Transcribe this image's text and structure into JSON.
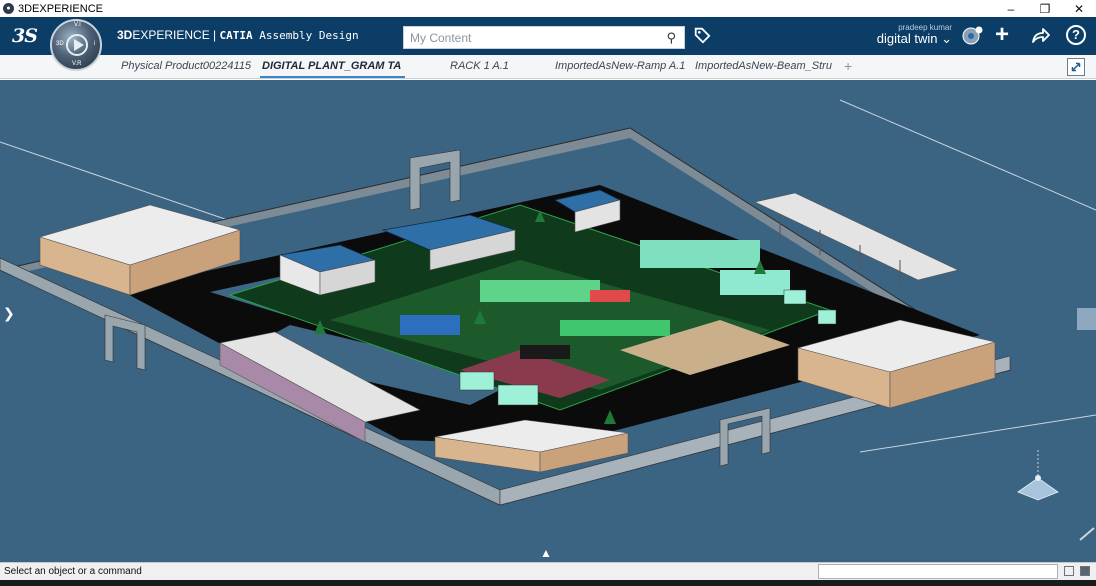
{
  "window": {
    "title": "3DEXPERIENCE"
  },
  "topbar": {
    "logo_text": "3S",
    "brand_bold": "3D",
    "brand_rest": "EXPERIENCE | ",
    "brand_app": "CATIA",
    "brand_module": " Assembly Design",
    "compass_top": "V.I",
    "compass_left": "3D",
    "compass_right": "i",
    "compass_bottom": "V.R",
    "search_placeholder": "My Content",
    "user_name": "pradeep kumar",
    "context_label": "digital twin",
    "colors": {
      "bar": "#0c3d66",
      "accent": "#3d86c6"
    }
  },
  "tabs": [
    {
      "label": "Physical Product00224115",
      "active": false
    },
    {
      "label": "DIGITAL PLANT_GRAM TA",
      "active": true
    },
    {
      "label": "RACK 1 A.1",
      "active": false
    },
    {
      "label": "ImportedAsNew-Ramp A.1",
      "active": false
    },
    {
      "label": "ImportedAsNew-Beam_Stru",
      "active": false
    }
  ],
  "tab_add": "+",
  "statusbar": {
    "message": "Select an object or a command",
    "command_value": ""
  },
  "icons": [
    "search-icon",
    "tag-icon",
    "compass-icon",
    "plus-icon",
    "share-icon",
    "help-icon",
    "fullscreen-icon"
  ]
}
